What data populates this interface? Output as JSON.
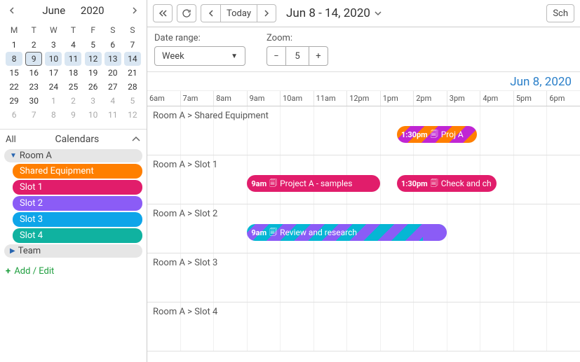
{
  "sidebar": {
    "month_name": "June",
    "year": "2020",
    "weekdays": [
      "M",
      "T",
      "W",
      "T",
      "F",
      "S",
      "S"
    ],
    "cells": [
      [
        {
          "n": 1
        },
        {
          "n": 2
        },
        {
          "n": 3
        },
        {
          "n": 4
        },
        {
          "n": 5
        },
        {
          "n": 6
        },
        {
          "n": 7
        }
      ],
      [
        {
          "n": 8,
          "sel": true
        },
        {
          "n": 9,
          "sel": true,
          "today": true
        },
        {
          "n": 10,
          "sel": true
        },
        {
          "n": 11,
          "sel": true
        },
        {
          "n": 12,
          "sel": true
        },
        {
          "n": 13,
          "sel": true
        },
        {
          "n": 14,
          "sel": true
        }
      ],
      [
        {
          "n": 15
        },
        {
          "n": 16
        },
        {
          "n": 17
        },
        {
          "n": 18
        },
        {
          "n": 19
        },
        {
          "n": 20
        },
        {
          "n": 21
        }
      ],
      [
        {
          "n": 22
        },
        {
          "n": 23
        },
        {
          "n": 24
        },
        {
          "n": 25
        },
        {
          "n": 26
        },
        {
          "n": 27
        },
        {
          "n": 28
        }
      ],
      [
        {
          "n": 29
        },
        {
          "n": 30
        },
        {
          "n": 1,
          "other": true
        },
        {
          "n": 2,
          "other": true
        },
        {
          "n": 3,
          "other": true
        },
        {
          "n": 4,
          "other": true
        },
        {
          "n": 5,
          "other": true
        }
      ],
      [
        {
          "n": 6,
          "other": true
        },
        {
          "n": 7,
          "other": true
        },
        {
          "n": 8,
          "other": true
        },
        {
          "n": 9,
          "other": true
        },
        {
          "n": 10,
          "other": true
        },
        {
          "n": 11,
          "other": true
        },
        {
          "n": 12,
          "other": true
        }
      ]
    ],
    "all_label": "All",
    "section_title": "Calendars",
    "groups": [
      {
        "name": "Room A",
        "expanded": true,
        "items": [
          {
            "label": "Shared Equipment",
            "color": "#ff7f00"
          },
          {
            "label": "Slot 1",
            "color": "#e11d6b"
          },
          {
            "label": "Slot 2",
            "color": "#8b5cf6"
          },
          {
            "label": "Slot 3",
            "color": "#0ea5e9"
          },
          {
            "label": "Slot 4",
            "color": "#10b2a0"
          }
        ]
      },
      {
        "name": "Team",
        "expanded": false
      }
    ],
    "add_edit": "Add / Edit"
  },
  "toolbar": {
    "today_label": "Today",
    "range_title": "Jun 8 - 14, 2020",
    "right_button": "Sch"
  },
  "controls": {
    "date_range_label": "Date range:",
    "date_range_value": "Week",
    "zoom_label": "Zoom:",
    "zoom_value": "5"
  },
  "schedule": {
    "day_title": "Jun 8, 2020",
    "hours": [
      "6am",
      "7am",
      "8am",
      "9am",
      "10am",
      "11am",
      "12pm",
      "1pm",
      "2pm",
      "3pm",
      "4pm",
      "5pm",
      "6pm"
    ],
    "hour_start": 6,
    "resources": [
      {
        "label": "Room A > Shared Equipment",
        "events": [
          {
            "time": "1:30pm",
            "title": "Proj A",
            "start": 13.5,
            "end": 15.9,
            "style": "stripe-om"
          }
        ]
      },
      {
        "label": "Room A > Slot 1",
        "events": [
          {
            "time": "9am",
            "title": "Project A - samples",
            "start": 9,
            "end": 13,
            "style": "solid-m"
          },
          {
            "time": "1:30pm",
            "title": "Check and ch",
            "start": 13.5,
            "end": 16.5,
            "style": "solid-m"
          }
        ]
      },
      {
        "label": "Room A > Slot 2",
        "events": [
          {
            "time": "9am",
            "title": "Review and research",
            "start": 9,
            "end": 15,
            "style": "stripe-mb tail-purple"
          }
        ]
      },
      {
        "label": "Room A > Slot 3",
        "events": []
      },
      {
        "label": "Room A > Slot 4",
        "events": []
      }
    ]
  }
}
